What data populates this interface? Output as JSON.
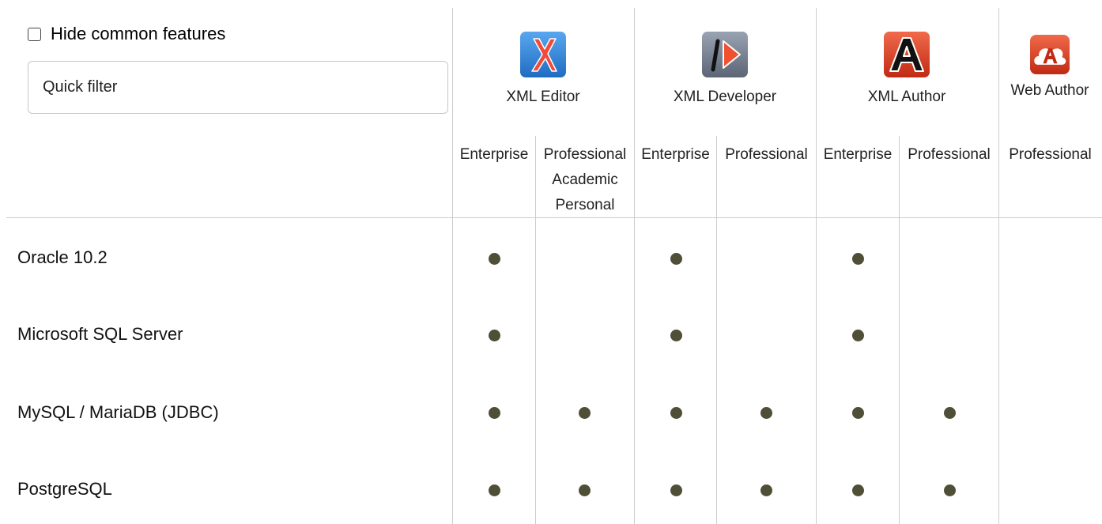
{
  "filter": {
    "hide_common_label": "Hide common features",
    "hide_common_checked": false,
    "quick_filter_placeholder": "Quick filter"
  },
  "products": [
    {
      "name": "XML Editor",
      "icon": "xml-editor-icon",
      "color": "#2f7fd6"
    },
    {
      "name": "XML Developer",
      "icon": "xml-developer-icon",
      "color": "#6f7a8c"
    },
    {
      "name": "XML Author",
      "icon": "xml-author-icon",
      "color": "#d63a22"
    },
    {
      "name": "Web Author",
      "icon": "web-author-icon",
      "color": "#d63a22"
    }
  ],
  "editions": [
    {
      "product": "XML Editor",
      "lines": [
        "Enterprise"
      ]
    },
    {
      "product": "XML Editor",
      "lines": [
        "Professional",
        "Academic",
        "Personal"
      ]
    },
    {
      "product": "XML Developer",
      "lines": [
        "Enterprise"
      ]
    },
    {
      "product": "XML Developer",
      "lines": [
        "Professional"
      ]
    },
    {
      "product": "XML Author",
      "lines": [
        "Enterprise"
      ]
    },
    {
      "product": "XML Author",
      "lines": [
        "Professional"
      ]
    },
    {
      "product": "Web Author",
      "lines": [
        "Professional"
      ]
    }
  ],
  "features": [
    {
      "name": "Oracle 10.2",
      "support": [
        true,
        false,
        true,
        false,
        true,
        false,
        false
      ]
    },
    {
      "name": "Microsoft SQL Server",
      "support": [
        true,
        false,
        true,
        false,
        true,
        false,
        false
      ]
    },
    {
      "name": "MySQL / MariaDB (JDBC)",
      "support": [
        true,
        true,
        true,
        true,
        true,
        true,
        false
      ]
    },
    {
      "name": "PostgreSQL",
      "support": [
        true,
        true,
        true,
        true,
        true,
        true,
        false
      ]
    }
  ],
  "colors": {
    "dot": "#4f4f38",
    "grid": "#cccccc"
  }
}
